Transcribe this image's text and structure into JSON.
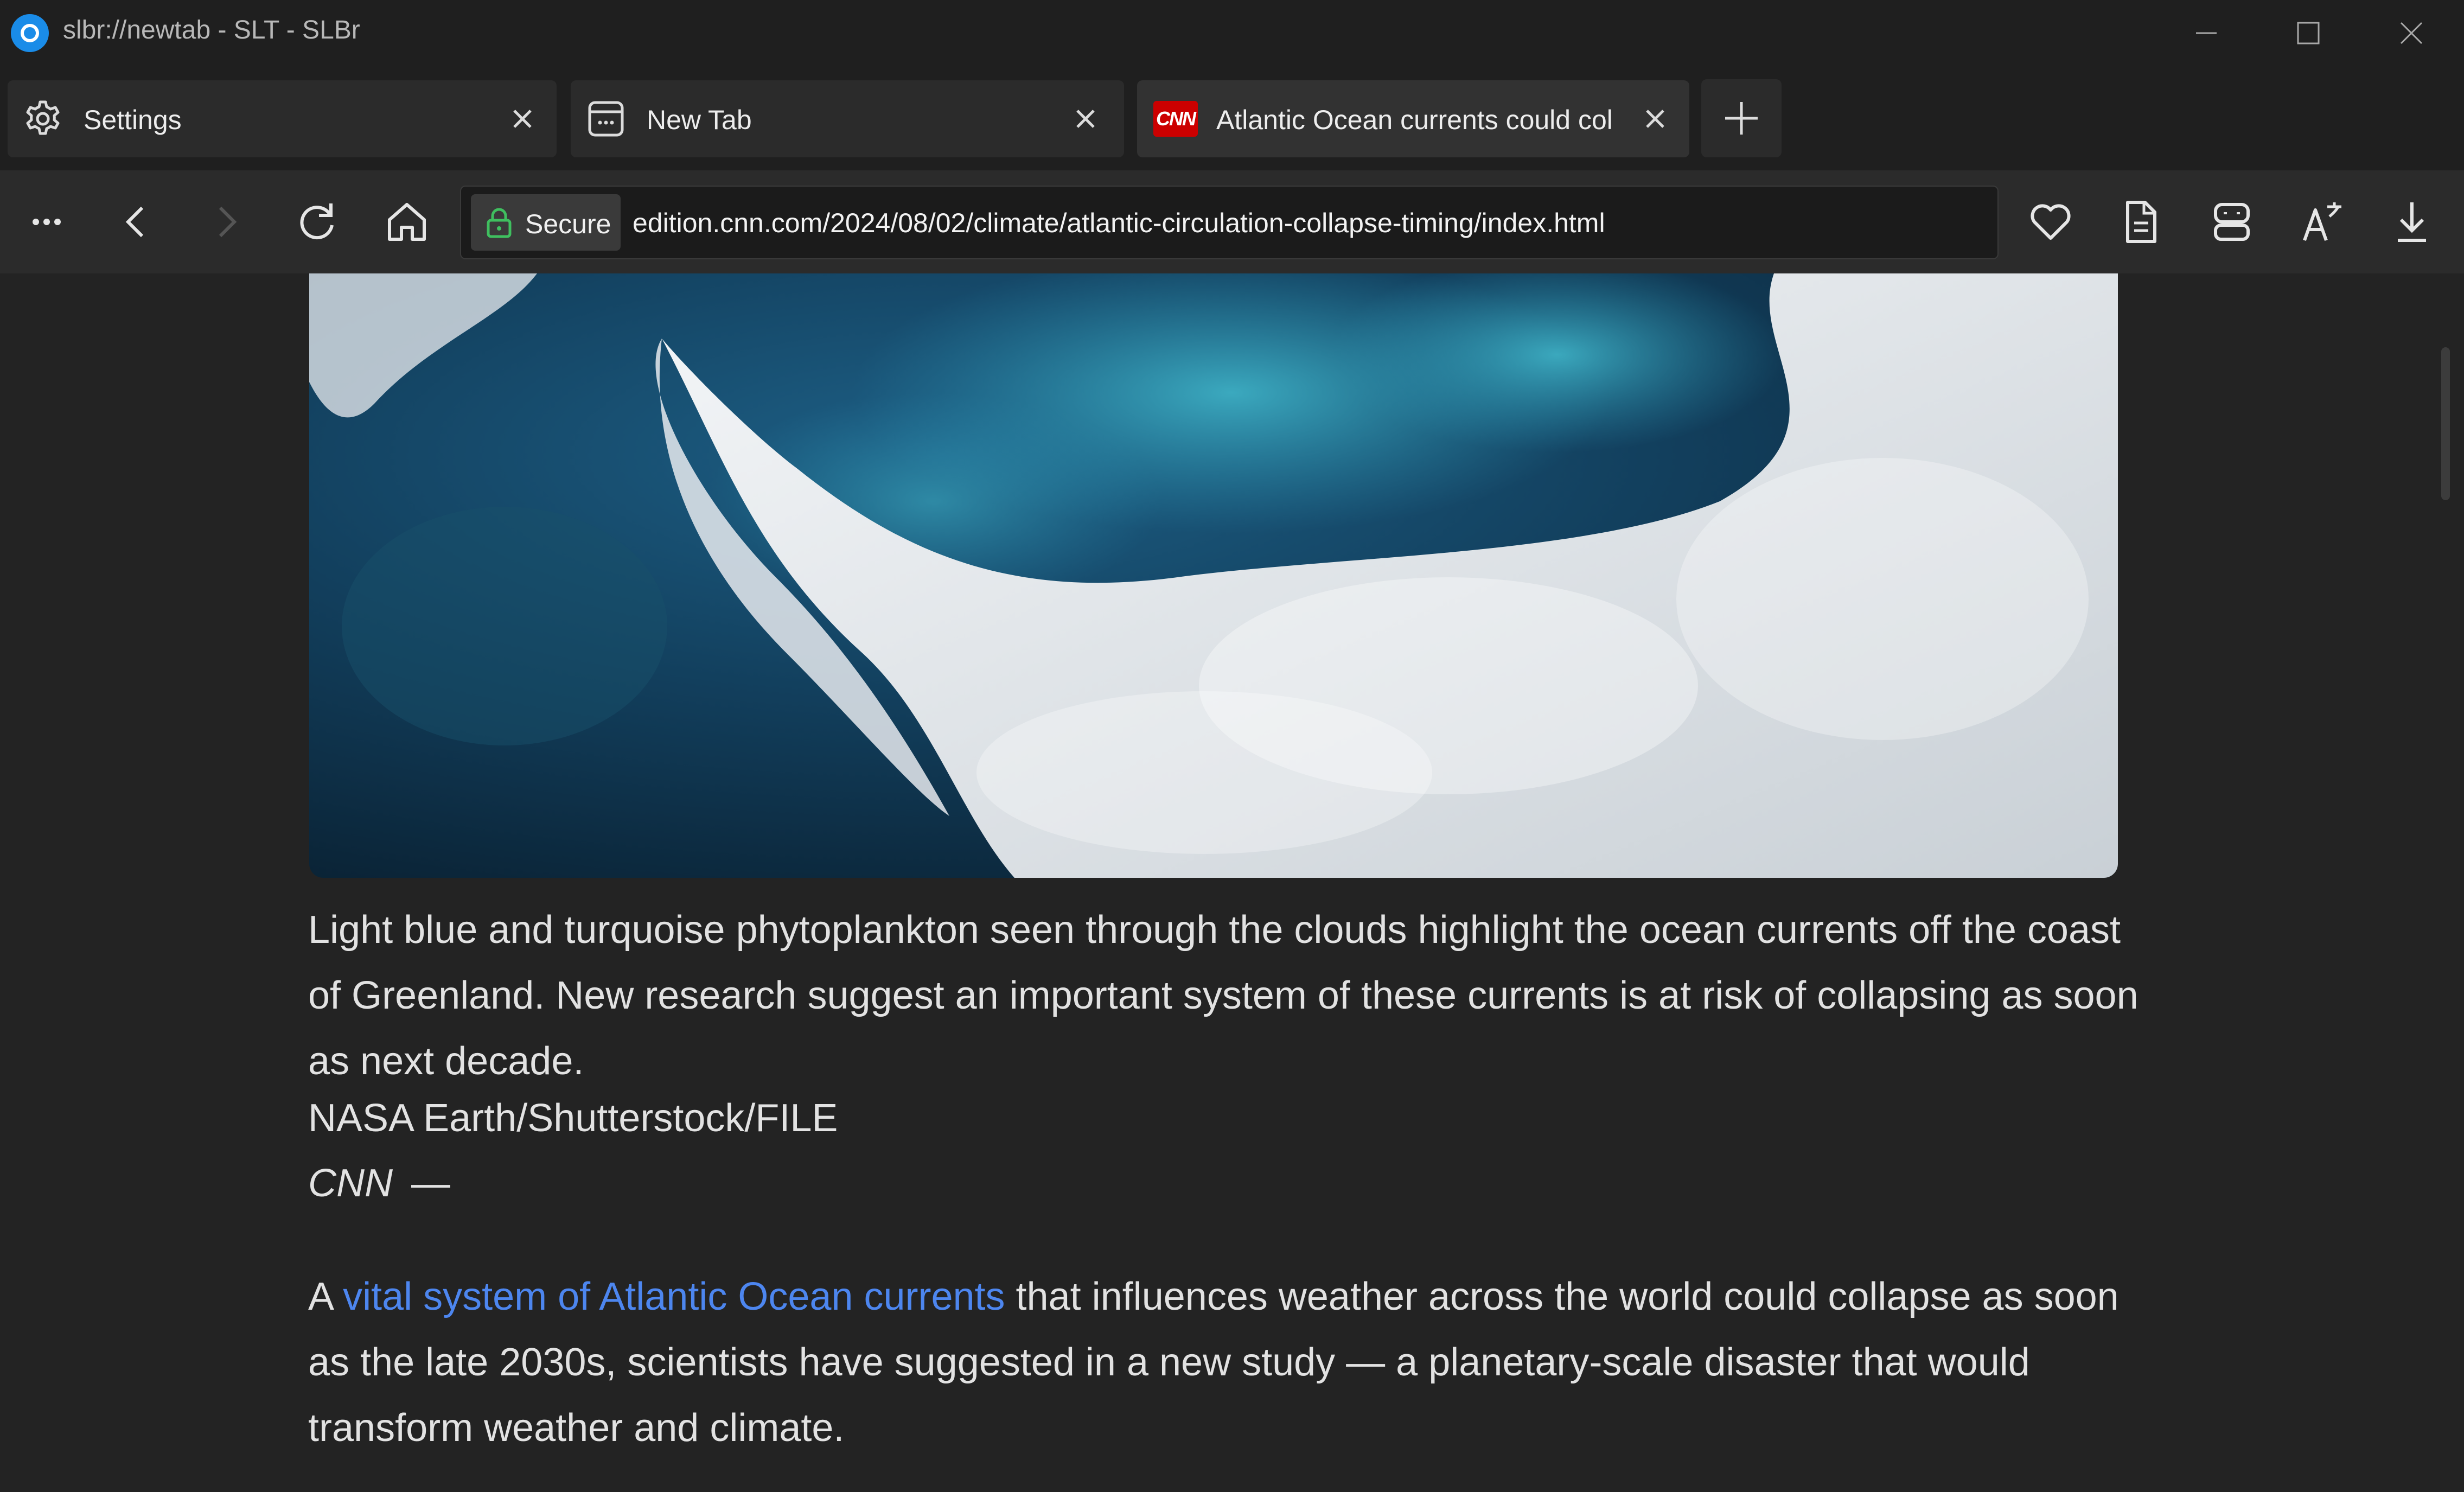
{
  "window": {
    "title": "slbr://newtab - SLT - SLBr"
  },
  "tabs": [
    {
      "label": "Settings",
      "icon": "gear-icon"
    },
    {
      "label": "New Tab",
      "icon": "new-tab-page-icon"
    },
    {
      "label": "Atlantic Ocean currents could col",
      "icon": "cnn-favicon",
      "favicon_text": "CNN"
    }
  ],
  "toolbar": {
    "secure_label": "Secure",
    "url": "edition.cnn.com/2024/08/02/climate/atlantic-circulation-collapse-timing/index.html"
  },
  "article": {
    "caption": "Light blue and turquoise phytoplankton seen through the clouds highlight the ocean currents off the coast of Greenland. New research suggest an important system of these currents is at risk of collapsing as soon as next decade.",
    "credit": "NASA Earth/Shutterstock/FILE",
    "byline_source": "CNN",
    "byline_dash": "—",
    "para_prefix": "A ",
    "para_link": "vital system of Atlantic Ocean currents",
    "para_rest": " that influences weather across the world could collapse as soon as the late 2030s, scientists have suggested in a new study — a planetary-scale disaster that would transform weather and climate."
  },
  "colors": {
    "link": "#4d86ef",
    "background": "#232323",
    "cnn_red": "#cc0000",
    "app_accent": "#1a8ce8"
  }
}
